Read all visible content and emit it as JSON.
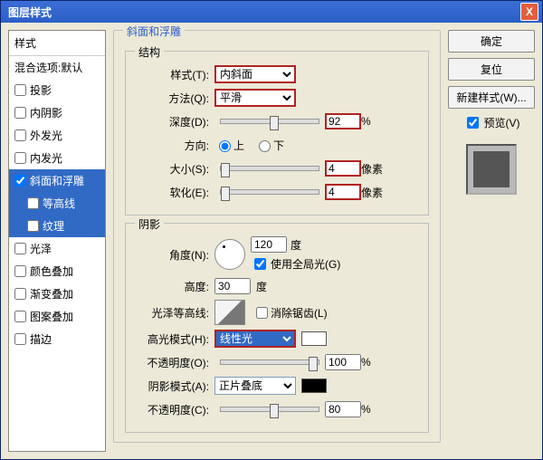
{
  "window": {
    "title": "图层样式",
    "close": "X"
  },
  "left": {
    "header": "样式",
    "blend": "混合选项:默认",
    "items": [
      {
        "label": "投影",
        "checked": false
      },
      {
        "label": "内阴影",
        "checked": false
      },
      {
        "label": "外发光",
        "checked": false
      },
      {
        "label": "内发光",
        "checked": false
      }
    ],
    "bevel": {
      "label": "斜面和浮雕",
      "checked": true
    },
    "bevel_sub": [
      {
        "label": "等高线",
        "checked": false
      },
      {
        "label": "纹理",
        "checked": false
      }
    ],
    "items2": [
      {
        "label": "光泽",
        "checked": false
      },
      {
        "label": "颜色叠加",
        "checked": false
      },
      {
        "label": "渐变叠加",
        "checked": false
      },
      {
        "label": "图案叠加",
        "checked": false
      },
      {
        "label": "描边",
        "checked": false
      }
    ]
  },
  "struct": {
    "group": "斜面和浮雕",
    "sub": "结构",
    "style_l": "样式(T):",
    "style_v": "内斜面",
    "tech_l": "方法(Q):",
    "tech_v": "平滑",
    "depth_l": "深度(D):",
    "depth_v": "92",
    "pct": "%",
    "dir_l": "方向:",
    "up": "上",
    "down": "下",
    "size_l": "大小(S):",
    "size_v": "4",
    "px": "像素",
    "soft_l": "软化(E):",
    "soft_v": "4"
  },
  "shadow": {
    "sub": "阴影",
    "angle_l": "角度(N):",
    "angle_v": "120",
    "deg": "度",
    "global": "使用全局光(G)",
    "alt_l": "高度:",
    "alt_v": "30",
    "gloss_l": "光泽等高线:",
    "anti": "消除锯齿(L)",
    "hmode_l": "高光模式(H):",
    "hmode_v": "线性光",
    "hopac_l": "不透明度(O):",
    "hopac_v": "100",
    "smode_l": "阴影模式(A):",
    "smode_v": "正片叠底",
    "sopac_l": "不透明度(C):",
    "sopac_v": "80"
  },
  "right": {
    "ok": "确定",
    "reset": "复位",
    "new": "新建样式(W)...",
    "preview": "预览(V)"
  }
}
